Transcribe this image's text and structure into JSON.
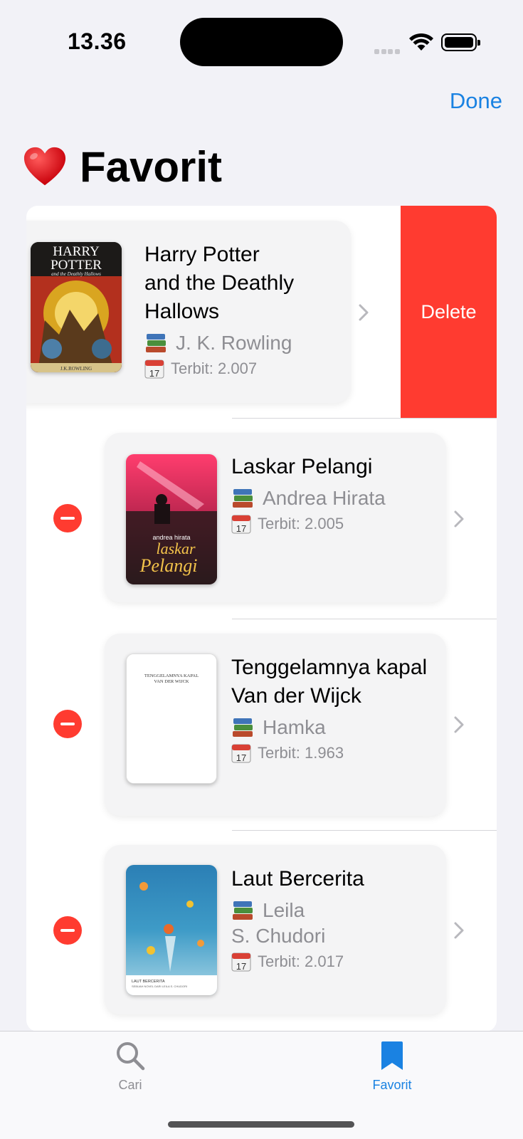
{
  "status_bar": {
    "time": "13.36"
  },
  "nav": {
    "done_label": "Done"
  },
  "page": {
    "title": "Favorit",
    "title_icon": "heart-icon"
  },
  "books": [
    {
      "title": "Harry Potter and the Deathly Hallows",
      "author": "J. K. Rowling",
      "year": "Terbit: 2.007",
      "swiped": true
    },
    {
      "title": "Laskar Pelangi",
      "author": "Andrea Hirata",
      "year": "Terbit: 2.005"
    },
    {
      "title": "Tenggelamnya kapal Van der Wijck",
      "author": "Hamka",
      "year": "Terbit: 1.963"
    },
    {
      "title": "Laut Bercerita",
      "author_line1": "Leila",
      "author_line2": "S. Chudori",
      "year": "Terbit: 2.017"
    }
  ],
  "covers": {
    "hp_line1": "HARRY",
    "hp_line2": "POTTER",
    "hp_subtitle": "and the Deathly Hallows",
    "hp_author": "J.K.ROWLING",
    "lp_author": "andrea   hirata",
    "lp_title1": "laskar",
    "lp_title2": "Pelangi",
    "tk_title1": "TENGGELAMNYA KAPAL",
    "tk_title2": "VAN DER WIJCK",
    "lb_title": "LAUT BERCERITA",
    "lb_sub": "SEBUAH NOVEL DARI LEILA S. CHUDORI"
  },
  "delete_label": "Delete",
  "tabs": [
    {
      "label": "Cari",
      "icon": "search-icon",
      "active": false
    },
    {
      "label": "Favorit",
      "icon": "bookmark-icon",
      "active": true
    }
  ],
  "colors": {
    "accent": "#1a82e2",
    "destructive": "#ff3b30",
    "secondary_text": "#8e8e93"
  }
}
